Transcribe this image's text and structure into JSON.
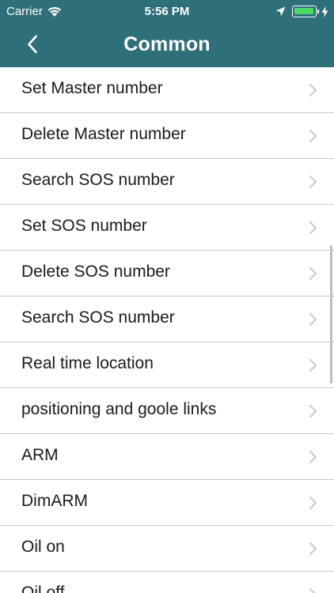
{
  "status_bar": {
    "carrier": "Carrier",
    "time": "5:56 PM"
  },
  "nav": {
    "title": "Common",
    "back_icon": "chevron-left-icon"
  },
  "colors": {
    "header_bg": "#2e6f7a",
    "battery_green": "#4cd964",
    "separator": "#c8c7cc",
    "chevron": "#c7c7cc"
  },
  "list": {
    "items": [
      {
        "label": "Set Master number"
      },
      {
        "label": "Delete Master number"
      },
      {
        "label": "Search SOS number"
      },
      {
        "label": "Set SOS number"
      },
      {
        "label": "Delete SOS number"
      },
      {
        "label": "Search SOS number"
      },
      {
        "label": "Real time location"
      },
      {
        "label": "positioning and goole links"
      },
      {
        "label": "ARM"
      },
      {
        "label": "DimARM"
      },
      {
        "label": "Oil on"
      },
      {
        "label": "Oil off"
      }
    ]
  }
}
